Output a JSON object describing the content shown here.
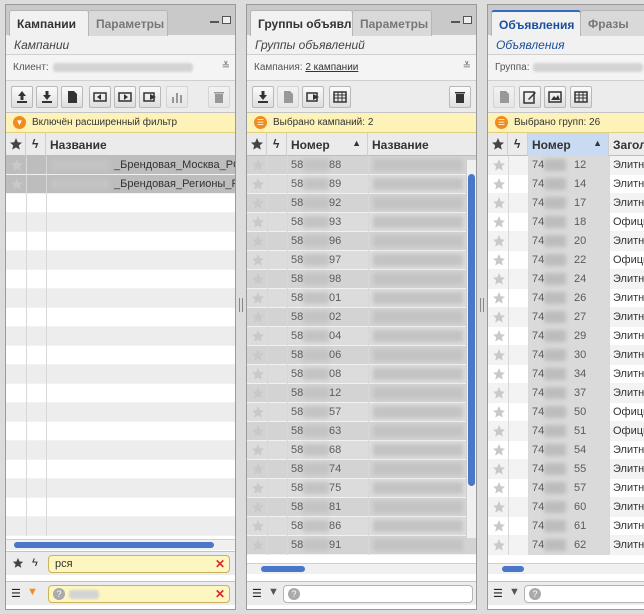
{
  "panels": {
    "campaigns": {
      "tabs": [
        "Кампании",
        "Параметры"
      ],
      "subtitle": "Кампании",
      "filter_label": "Клиент:",
      "info": "Включён расширенный фильтр",
      "columns": [
        "Название"
      ],
      "rows": [
        "_Брендовая_Москва_РС",
        "_Брендовая_Регионы_Р"
      ],
      "search_value": "рся"
    },
    "groups": {
      "tabs": [
        "Группы объявл...",
        "Параметры"
      ],
      "subtitle": "Группы объявлений",
      "filter_label": "Кампания:",
      "filter_link": "2 кампании",
      "info": "Выбрано кампаний: 2",
      "columns": [
        "Номер",
        "Название"
      ],
      "rows": [
        [
          "58",
          "88"
        ],
        [
          "58",
          "89"
        ],
        [
          "58",
          "92"
        ],
        [
          "58",
          "93"
        ],
        [
          "58",
          "96"
        ],
        [
          "58",
          "97"
        ],
        [
          "58",
          "98"
        ],
        [
          "58",
          "01"
        ],
        [
          "58",
          "02"
        ],
        [
          "58",
          "04"
        ],
        [
          "58",
          "06"
        ],
        [
          "58",
          "08"
        ],
        [
          "58",
          "12"
        ],
        [
          "58",
          "57"
        ],
        [
          "58",
          "63"
        ],
        [
          "58",
          "68"
        ],
        [
          "58",
          "74"
        ],
        [
          "58",
          "75"
        ],
        [
          "58",
          "81"
        ],
        [
          "58",
          "86"
        ],
        [
          "58",
          "91"
        ]
      ]
    },
    "ads": {
      "tabs": [
        "Объявления",
        "Фразы"
      ],
      "subtitle": "Объявления",
      "filter_label": "Группа:",
      "info": "Выбрано групп: 26",
      "columns": [
        "Номер",
        "Загол"
      ],
      "rows": [
        [
          "74",
          "12",
          "Элитн"
        ],
        [
          "74",
          "14",
          "Элитн"
        ],
        [
          "74",
          "17",
          "Элитн"
        ],
        [
          "74",
          "18",
          "Офици"
        ],
        [
          "74",
          "20",
          "Элитн"
        ],
        [
          "74",
          "22",
          "Офици"
        ],
        [
          "74",
          "24",
          "Элитн"
        ],
        [
          "74",
          "26",
          "Элитн"
        ],
        [
          "74",
          "27",
          "Элитн"
        ],
        [
          "74",
          "29",
          "Элитн"
        ],
        [
          "74",
          "30",
          "Элитн"
        ],
        [
          "74",
          "34",
          "Элитн"
        ],
        [
          "74",
          "37",
          "Элитн"
        ],
        [
          "74",
          "50",
          "Офици"
        ],
        [
          "74",
          "51",
          "Офици"
        ],
        [
          "74",
          "54",
          "Элитн"
        ],
        [
          "74",
          "55",
          "Элитн"
        ],
        [
          "74",
          "57",
          "Элитн"
        ],
        [
          "74",
          "60",
          "Элитн"
        ],
        [
          "74",
          "61",
          "Элитн"
        ],
        [
          "74",
          "62",
          "Элитн"
        ]
      ]
    }
  },
  "colors": {
    "accent": "#2d6bc8",
    "info_bg": "#fdf3b8",
    "info_icon": "#f08b1d",
    "clear_x": "#d42b2b"
  }
}
